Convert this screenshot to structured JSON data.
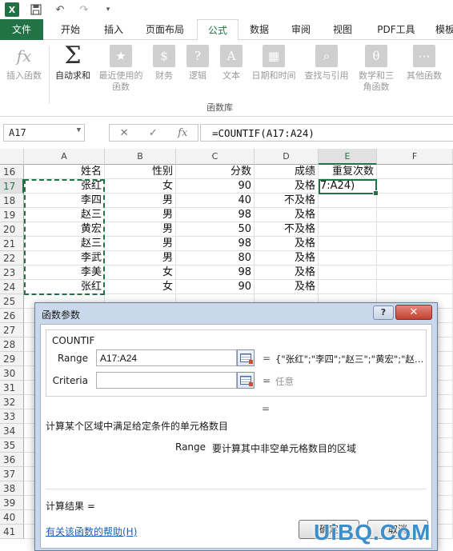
{
  "titlebar": {
    "app_icon": "X",
    "save_icon": "save-icon",
    "undo_icon": "undo-icon",
    "redo_icon": "redo-icon"
  },
  "tabs": [
    "文件",
    "开始",
    "插入",
    "页面布局",
    "公式",
    "数据",
    "审阅",
    "视图",
    "PDF工具",
    "模板"
  ],
  "active_tab": "公式",
  "ribbon": {
    "buttons": [
      "插入函数",
      "自动求和",
      "最近使用的函数",
      "财务",
      "逻辑",
      "文本",
      "日期和时间",
      "查找与引用",
      "数学和三角函数",
      "其他函数"
    ],
    "group_label": "函数库"
  },
  "formula_bar": {
    "name_box": "A17",
    "formula": "=COUNTIF(A17:A24)",
    "fx": "fx"
  },
  "columns": [
    "A",
    "B",
    "C",
    "D",
    "E",
    "F"
  ],
  "rows": [
    "16",
    "17",
    "18",
    "19",
    "20",
    "21",
    "22",
    "23",
    "24",
    "25",
    "26",
    "27",
    "28",
    "29",
    "30",
    "31",
    "32",
    "33",
    "34",
    "35",
    "36",
    "37",
    "38",
    "39",
    "40",
    "41"
  ],
  "table": {
    "headers": [
      "姓名",
      "性别",
      "分数",
      "成绩",
      "重复次数"
    ],
    "data": [
      [
        "张红",
        "女",
        "90",
        "及格"
      ],
      [
        "李四",
        "男",
        "40",
        "不及格"
      ],
      [
        "赵三",
        "男",
        "98",
        "及格"
      ],
      [
        "黄宏",
        "男",
        "50",
        "不及格"
      ],
      [
        "赵三",
        "男",
        "98",
        "及格"
      ],
      [
        "李武",
        "男",
        "80",
        "及格"
      ],
      [
        "李美",
        "女",
        "98",
        "及格"
      ],
      [
        "张红",
        "女",
        "90",
        "及格"
      ]
    ],
    "active_cell_text": "7:A24)"
  },
  "dialog": {
    "title": "函数参数",
    "help_label": "?",
    "close_label": "✕",
    "function_name": "COUNTIF",
    "range_label": "Range",
    "range_value": "A17:A24",
    "range_result": "{\"张红\";\"李四\";\"赵三\";\"黄宏\";\"赵…",
    "criteria_label": "Criteria",
    "criteria_value": "",
    "criteria_result": "任意",
    "eq": "=",
    "description": "计算某个区域中满足给定条件的单元格数目",
    "arg_name": "Range",
    "arg_description": "要计算其中非空单元格数目的区域",
    "result_label": "计算结果 =",
    "help_link": "有关该函数的帮助(H)",
    "ok_label": "确定",
    "cancel_label": "取消"
  },
  "watermark": "UiBQ.CoM"
}
